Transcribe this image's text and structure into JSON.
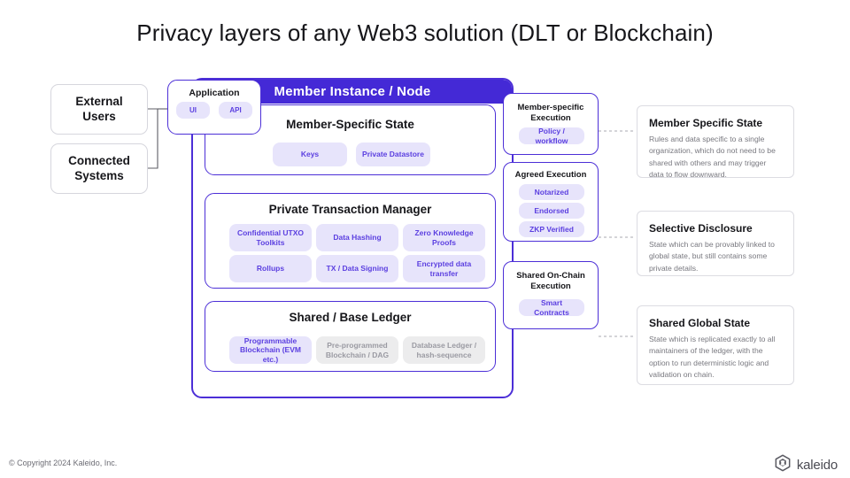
{
  "title": "Privacy layers of any Web3 solution (DLT or Blockchain)",
  "colors": {
    "brand_purple": "#4429d6",
    "border_purple": "#4c2fd7",
    "pill_bg": "#e7e4fb",
    "pill_text": "#5b3fe0",
    "muted_pill_bg": "#ececed",
    "muted_pill_text": "#9a9aa2",
    "note_border": "#dcdce2",
    "arrow_gray": "#6d6d75"
  },
  "left_entities": [
    {
      "label": "External Users"
    },
    {
      "label": "Connected Systems"
    }
  ],
  "application": {
    "title": "Application",
    "pills": [
      {
        "label": "UI"
      },
      {
        "label": "API"
      }
    ]
  },
  "member_instance": {
    "header": "Member Instance / Node",
    "layers": [
      {
        "title": "Member-Specific State",
        "pills": [
          {
            "label": "Keys",
            "muted": false
          },
          {
            "label": "Private Datastore",
            "muted": false
          }
        ]
      },
      {
        "title": "Private Transaction Manager",
        "pills": [
          {
            "label": "Confidential UTXO Toolkits",
            "muted": false
          },
          {
            "label": "Data Hashing",
            "muted": false
          },
          {
            "label": "Zero Knowledge Proofs",
            "muted": false
          },
          {
            "label": "Rollups",
            "muted": false
          },
          {
            "label": "TX / Data Signing",
            "muted": false
          },
          {
            "label": "Encrypted data transfer",
            "muted": false
          }
        ]
      },
      {
        "title": "Shared / Base Ledger",
        "pills": [
          {
            "label": "Programmable Blockchain (EVM etc.)",
            "muted": false
          },
          {
            "label": "Pre-programmed Blockchain / DAG",
            "muted": true
          },
          {
            "label": "Database Ledger / hash-sequence",
            "muted": true
          }
        ]
      }
    ]
  },
  "execution_cards": [
    {
      "title": "Member-specific Execution",
      "pills": [
        {
          "label": "Policy / workflow"
        }
      ]
    },
    {
      "title": "Agreed Execution",
      "pills": [
        {
          "label": "Notarized"
        },
        {
          "label": "Endorsed"
        },
        {
          "label": "ZKP Verified"
        }
      ]
    },
    {
      "title": "Shared On-Chain Execution",
      "pills": [
        {
          "label": "Smart Contracts"
        }
      ]
    }
  ],
  "annotations": [
    {
      "title": "Member Specific State",
      "body": "Rules and data specific to a single organization, which do not need to be shared with others and may trigger data to flow downward."
    },
    {
      "title": "Selective Disclosure",
      "body": "State which can be provably linked to global state, but still contains some private details."
    },
    {
      "title": "Shared Global State",
      "body": "State which is replicated exactly to all maintainers of the ledger, with the option to run deterministic logic and validation on chain."
    }
  ],
  "footer": {
    "copyright": "© Copyright 2024 Kaleido, Inc.",
    "brand": "kaleido"
  }
}
